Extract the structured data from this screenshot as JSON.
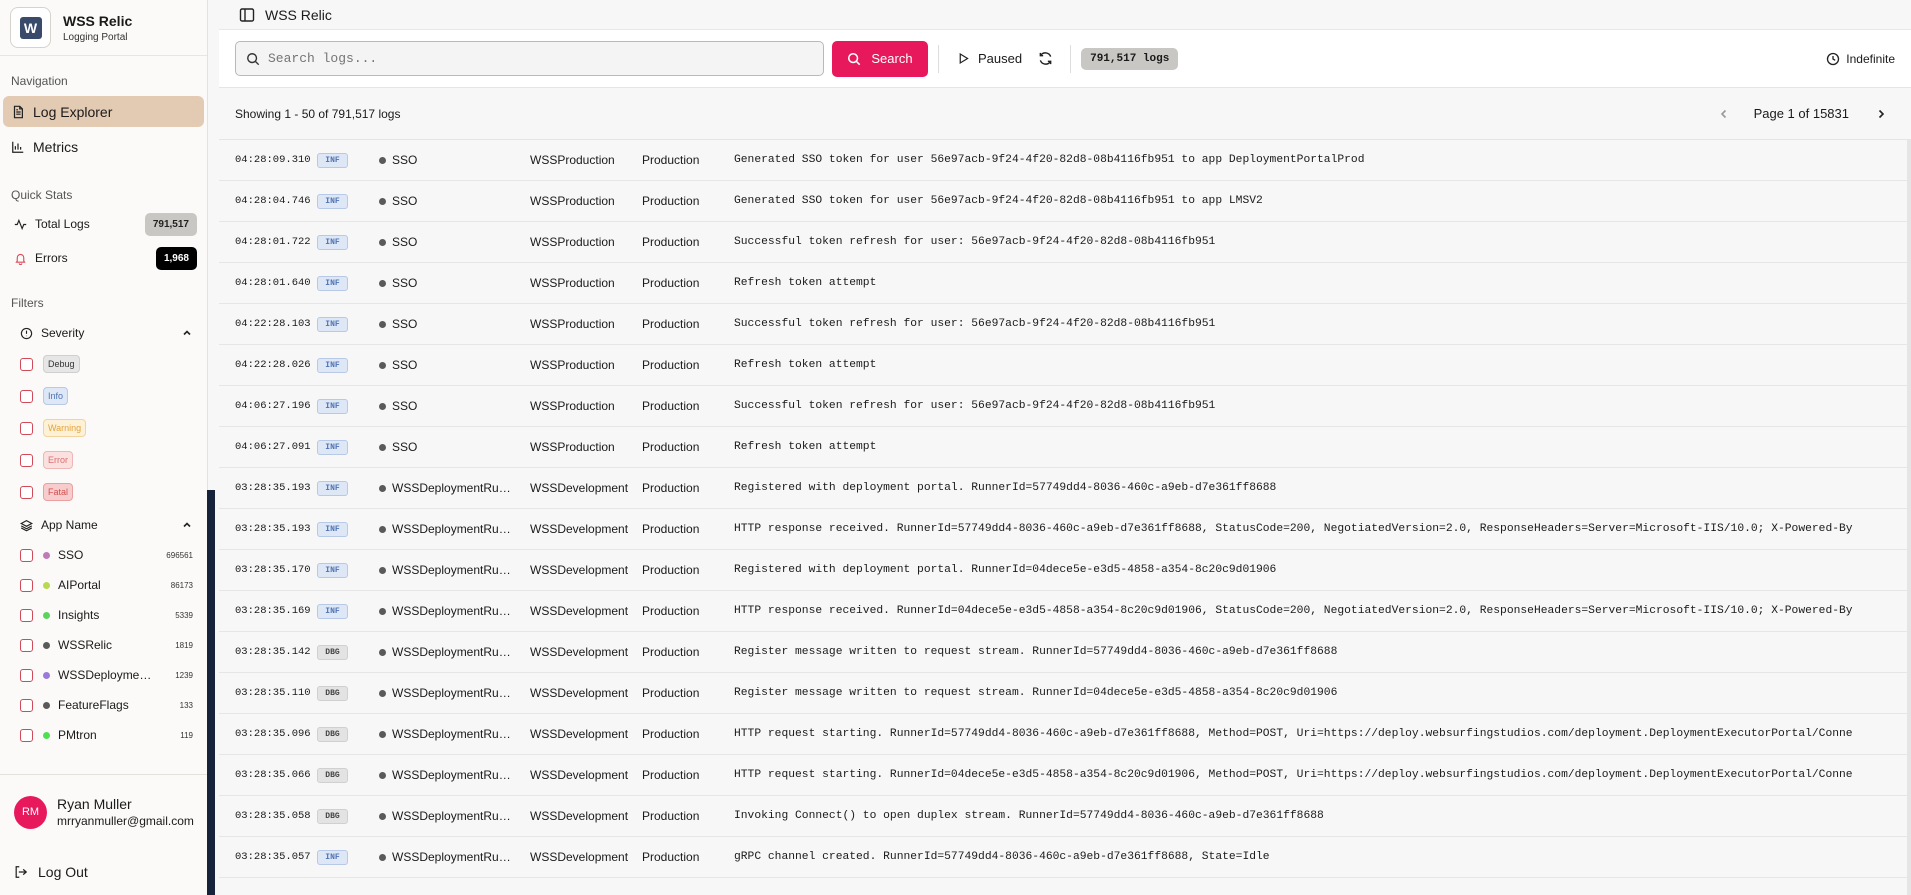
{
  "brand": {
    "title": "WSS Relic",
    "subtitle": "Logging Portal",
    "logo_letter": "W"
  },
  "nav": {
    "label": "Navigation",
    "items": [
      {
        "label": "Log Explorer",
        "icon": "file-text-icon",
        "active": true
      },
      {
        "label": "Metrics",
        "icon": "bar-chart-icon",
        "active": false
      }
    ]
  },
  "quick_stats": {
    "label": "Quick Stats",
    "total_logs": {
      "label": "Total Logs",
      "value": "791,517"
    },
    "errors": {
      "label": "Errors",
      "value": "1,968"
    }
  },
  "filters": {
    "label": "Filters",
    "severity": {
      "label": "Severity",
      "options": [
        {
          "label": "Debug",
          "bg": "#e6e6e6",
          "fg": "#333333",
          "border": "#cfcfcf"
        },
        {
          "label": "Info",
          "bg": "#dde7f5",
          "fg": "#4f73b5",
          "border": "#b7c9e6"
        },
        {
          "label": "Warning",
          "bg": "#fdf1d8",
          "fg": "#e3a33c",
          "border": "#f3d39a"
        },
        {
          "label": "Error",
          "bg": "#fbe0e0",
          "fg": "#d9706f",
          "border": "#f0b5b5"
        },
        {
          "label": "Fatal",
          "bg": "#f7cccc",
          "fg": "#d24f4f",
          "border": "#eba0a0"
        }
      ]
    },
    "app_name": {
      "label": "App Name",
      "options": [
        {
          "label": "SSO",
          "count": "696561",
          "color": "#c07ab8"
        },
        {
          "label": "AIPortal",
          "count": "86173",
          "color": "#b6d94f"
        },
        {
          "label": "Insights",
          "count": "5339",
          "color": "#5cd45c"
        },
        {
          "label": "WSSRelic",
          "count": "1819",
          "color": "#5a5a5a"
        },
        {
          "label": "WSSDeploymentRunner",
          "count": "1239",
          "color": "#9a7bd8"
        },
        {
          "label": "FeatureFlags",
          "count": "133",
          "color": "#5a5a5a"
        },
        {
          "label": "PMtron",
          "count": "119",
          "color": "#4fe04f"
        }
      ]
    }
  },
  "user": {
    "initials": "RM",
    "name": "Ryan Muller",
    "email": "mrryanmuller@gmail.com"
  },
  "logout": {
    "label": "Log Out"
  },
  "topbar": {
    "title": "WSS Relic"
  },
  "toolbar": {
    "search_placeholder": "Search logs...",
    "search_button": "Search",
    "paused_label": "Paused",
    "logs_count": "791,517 logs",
    "range_label": "Indefinite"
  },
  "results": {
    "showing": "Showing 1 - 50 of 791,517 logs",
    "page_label": "Page 1 of 15831"
  },
  "logs": [
    {
      "time": "04:28:09.310",
      "level": "INF",
      "app": "SSO",
      "env": "WSSProduction",
      "stage": "Production",
      "msg": "Generated SSO token for user 56e97acb-9f24-4f20-82d8-08b4116fb951 to app DeploymentPortalProd"
    },
    {
      "time": "04:28:04.746",
      "level": "INF",
      "app": "SSO",
      "env": "WSSProduction",
      "stage": "Production",
      "msg": "Generated SSO token for user 56e97acb-9f24-4f20-82d8-08b4116fb951 to app LMSV2"
    },
    {
      "time": "04:28:01.722",
      "level": "INF",
      "app": "SSO",
      "env": "WSSProduction",
      "stage": "Production",
      "msg": "Successful token refresh for user: 56e97acb-9f24-4f20-82d8-08b4116fb951"
    },
    {
      "time": "04:28:01.640",
      "level": "INF",
      "app": "SSO",
      "env": "WSSProduction",
      "stage": "Production",
      "msg": "Refresh token attempt"
    },
    {
      "time": "04:22:28.103",
      "level": "INF",
      "app": "SSO",
      "env": "WSSProduction",
      "stage": "Production",
      "msg": "Successful token refresh for user: 56e97acb-9f24-4f20-82d8-08b4116fb951"
    },
    {
      "time": "04:22:28.026",
      "level": "INF",
      "app": "SSO",
      "env": "WSSProduction",
      "stage": "Production",
      "msg": "Refresh token attempt"
    },
    {
      "time": "04:06:27.196",
      "level": "INF",
      "app": "SSO",
      "env": "WSSProduction",
      "stage": "Production",
      "msg": "Successful token refresh for user: 56e97acb-9f24-4f20-82d8-08b4116fb951"
    },
    {
      "time": "04:06:27.091",
      "level": "INF",
      "app": "SSO",
      "env": "WSSProduction",
      "stage": "Production",
      "msg": "Refresh token attempt"
    },
    {
      "time": "03:28:35.193",
      "level": "INF",
      "app": "WSSDeploymentRunner",
      "env": "WSSDevelopment",
      "stage": "Production",
      "msg": "Registered with deployment portal. RunnerId=57749dd4-8036-460c-a9eb-d7e361ff8688"
    },
    {
      "time": "03:28:35.193",
      "level": "INF",
      "app": "WSSDeploymentRunner",
      "env": "WSSDevelopment",
      "stage": "Production",
      "msg": "HTTP response received. RunnerId=57749dd4-8036-460c-a9eb-d7e361ff8688, StatusCode=200, NegotiatedVersion=2.0, ResponseHeaders=Server=Microsoft-IIS/10.0; X-Powered-By"
    },
    {
      "time": "03:28:35.170",
      "level": "INF",
      "app": "WSSDeploymentRunner",
      "env": "WSSDevelopment",
      "stage": "Production",
      "msg": "Registered with deployment portal. RunnerId=04dece5e-e3d5-4858-a354-8c20c9d01906"
    },
    {
      "time": "03:28:35.169",
      "level": "INF",
      "app": "WSSDeploymentRunner",
      "env": "WSSDevelopment",
      "stage": "Production",
      "msg": "HTTP response received. RunnerId=04dece5e-e3d5-4858-a354-8c20c9d01906, StatusCode=200, NegotiatedVersion=2.0, ResponseHeaders=Server=Microsoft-IIS/10.0; X-Powered-By"
    },
    {
      "time": "03:28:35.142",
      "level": "DBG",
      "app": "WSSDeploymentRunner",
      "env": "WSSDevelopment",
      "stage": "Production",
      "msg": "Register message written to request stream. RunnerId=57749dd4-8036-460c-a9eb-d7e361ff8688"
    },
    {
      "time": "03:28:35.110",
      "level": "DBG",
      "app": "WSSDeploymentRunner",
      "env": "WSSDevelopment",
      "stage": "Production",
      "msg": "Register message written to request stream. RunnerId=04dece5e-e3d5-4858-a354-8c20c9d01906"
    },
    {
      "time": "03:28:35.096",
      "level": "DBG",
      "app": "WSSDeploymentRunner",
      "env": "WSSDevelopment",
      "stage": "Production",
      "msg": "HTTP request starting. RunnerId=57749dd4-8036-460c-a9eb-d7e361ff8688, Method=POST, Uri=https://deploy.websurfingstudios.com/deployment.DeploymentExecutorPortal/Conne"
    },
    {
      "time": "03:28:35.066",
      "level": "DBG",
      "app": "WSSDeploymentRunner",
      "env": "WSSDevelopment",
      "stage": "Production",
      "msg": "HTTP request starting. RunnerId=04dece5e-e3d5-4858-a354-8c20c9d01906, Method=POST, Uri=https://deploy.websurfingstudios.com/deployment.DeploymentExecutorPortal/Conne"
    },
    {
      "time": "03:28:35.058",
      "level": "DBG",
      "app": "WSSDeploymentRunner",
      "env": "WSSDevelopment",
      "stage": "Production",
      "msg": "Invoking Connect() to open duplex stream. RunnerId=57749dd4-8036-460c-a9eb-d7e361ff8688"
    },
    {
      "time": "03:28:35.057",
      "level": "INF",
      "app": "WSSDeploymentRunner",
      "env": "WSSDevelopment",
      "stage": "Production",
      "msg": "gRPC channel created. RunnerId=57749dd4-8036-460c-a9eb-d7e361ff8688, State=Idle"
    }
  ]
}
